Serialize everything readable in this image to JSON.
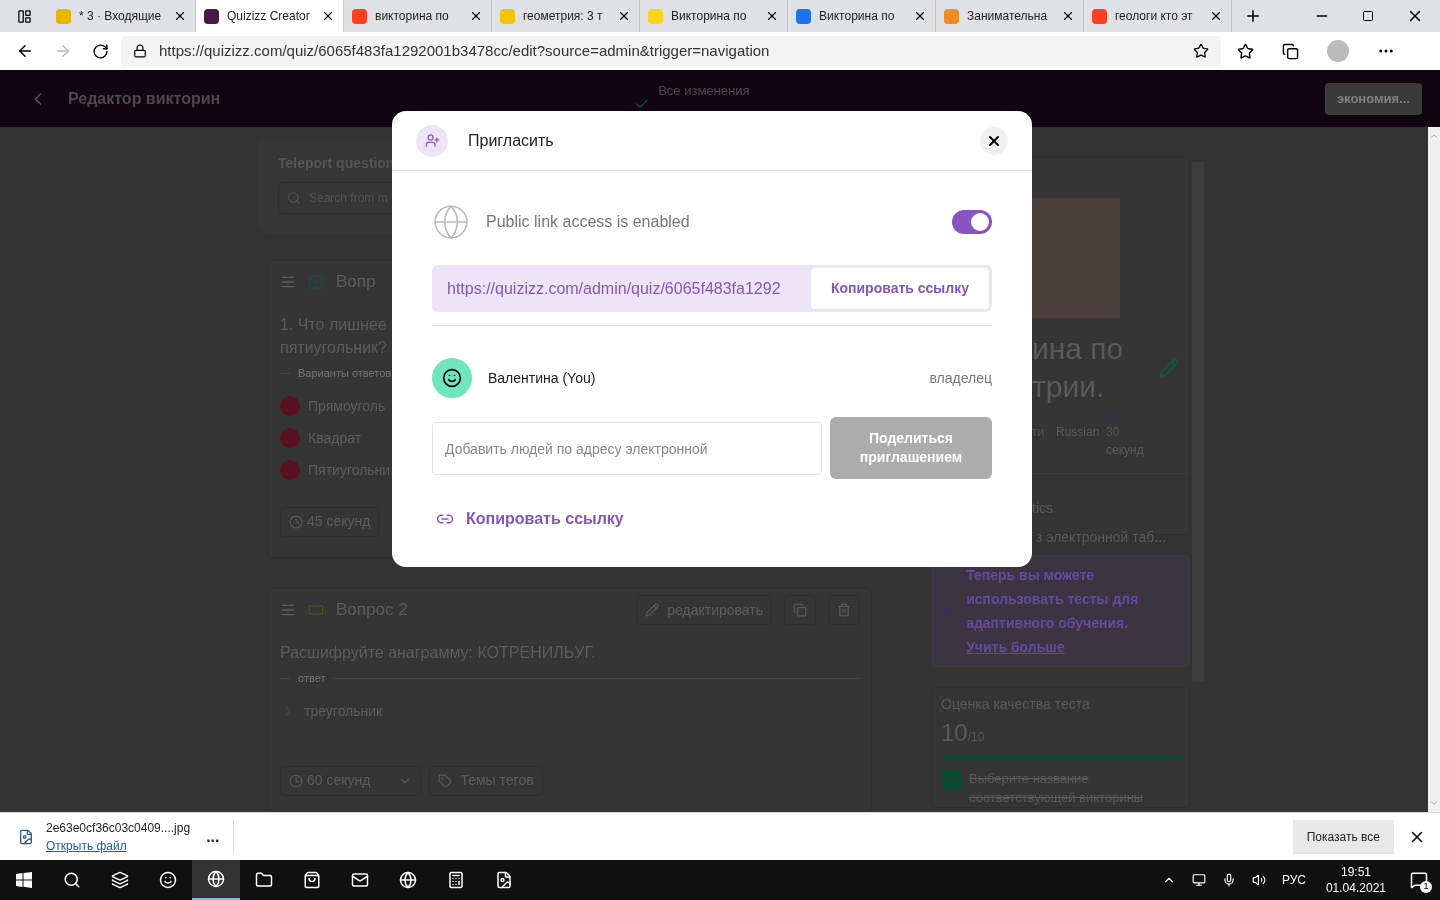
{
  "browser": {
    "tabs": [
      {
        "title": "* 3 · Входящие",
        "selected": false,
        "color": "#e8b400"
      },
      {
        "title": "Quizizz Creator",
        "selected": true,
        "color": "#461a42"
      },
      {
        "title": "викторина по",
        "selected": false,
        "color": "#fc3f1d"
      },
      {
        "title": "геометрия: 3 т",
        "selected": false,
        "color": "#f5c400"
      },
      {
        "title": "Викторина по",
        "selected": false,
        "color": "#ffd21e"
      },
      {
        "title": "Викторина по",
        "selected": false,
        "color": "#1a73e8"
      },
      {
        "title": "Занимательна",
        "selected": false,
        "color": "#f08a24"
      },
      {
        "title": "геологи кто эт",
        "selected": false,
        "color": "#fc3f1d"
      }
    ],
    "url": "https://quizizz.com/quiz/6065f483fa1292001b3478cc/edit?source=admin&trigger=navigation"
  },
  "app_header": {
    "title": "Редактор викторин",
    "save_status": "Все изменения",
    "save_button": "экономия..."
  },
  "teleport": {
    "label": "Teleport question",
    "placeholder": "Search from m"
  },
  "questions": [
    {
      "kind": "choice",
      "title": "Вопр",
      "text_lines": [
        "1. Что лишнее",
        "пятиугольник?"
      ],
      "answers_label": "Варианты ответов",
      "options": [
        {
          "text": "Прямоуголь",
          "color": "#5b1020"
        },
        {
          "text": "Квадрат",
          "color": "#5b1020"
        },
        {
          "text": "Пятиугольни",
          "color": "#5b1020"
        }
      ],
      "time": "45 секунд"
    },
    {
      "kind": "text",
      "title": "Вопрос 2",
      "edit": "редактировать",
      "text_lines": [
        "Расшифруйте анаграмму: КОТРЕНИЛЬУГ."
      ],
      "answers_label": "ответ",
      "options": [
        {
          "text": "треугольник"
        }
      ],
      "time": "60 секунд",
      "tags": "Темы тегов"
    }
  ],
  "quiz_panel": {
    "title_lines": [
      "ина по",
      "трии."
    ],
    "meta": [
      "ти",
      "Russian",
      "30 секунд"
    ],
    "subject": "tics",
    "import": "з электронной таб...",
    "promo": "Теперь вы можете использовать тесты для адаптивного обучения.",
    "promo_link": "Учить больше",
    "quality_label": "Оценка качества теста",
    "score": "10",
    "score_max": "/10",
    "level": 1,
    "checklist": [
      {
        "text": "Выберите название соответствующей викторины",
        "checked": true
      }
    ]
  },
  "modal": {
    "title": "Пригласить",
    "public_text": "Public link access is enabled",
    "public_on": true,
    "link": "https://quizizz.com/admin/quiz/6065f483fa1292",
    "copy_button": "Копировать ссылку",
    "user": "Валентина (You)",
    "role": "владелец",
    "email_placeholder": "Добавить людей по адресу электронной",
    "share_button": "Поделиться приглашением",
    "share_disabled": true,
    "copy_link": "Копировать ссылку"
  },
  "download_bar": {
    "file": "2e63e0cf36c03c0409....jpg",
    "open": "Открыть файл",
    "more": "...",
    "show_all": "Показать все"
  },
  "taskbar": {
    "language": "РУС",
    "time": "19:51",
    "date": "01.04.2021",
    "notifications": "1"
  }
}
